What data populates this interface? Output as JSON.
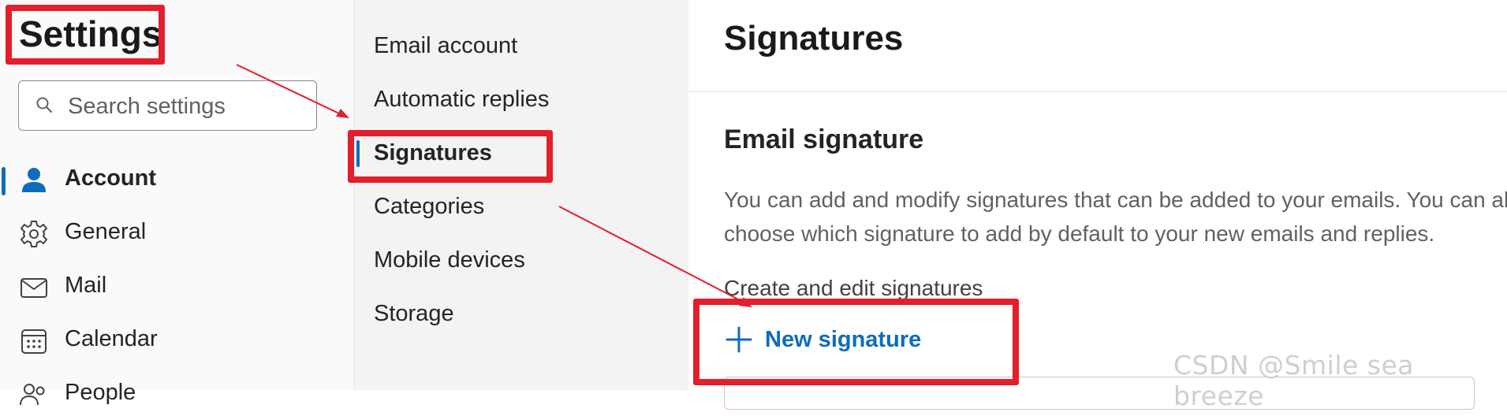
{
  "sidebar": {
    "title": "Settings",
    "search": {
      "placeholder": "Search settings",
      "icon": "search-icon"
    },
    "items": [
      {
        "label": "Account",
        "icon": "person-icon",
        "active": true
      },
      {
        "label": "General",
        "icon": "gear-icon",
        "active": false
      },
      {
        "label": "Mail",
        "icon": "mail-icon",
        "active": false
      },
      {
        "label": "Calendar",
        "icon": "calendar-icon",
        "active": false
      },
      {
        "label": "People",
        "icon": "people-icon",
        "active": false
      }
    ]
  },
  "subnav": {
    "items": [
      {
        "label": "Email account",
        "active": false
      },
      {
        "label": "Automatic replies",
        "active": false
      },
      {
        "label": "Signatures",
        "active": true
      },
      {
        "label": "Categories",
        "active": false
      },
      {
        "label": "Mobile devices",
        "active": false
      },
      {
        "label": "Storage",
        "active": false
      }
    ]
  },
  "main": {
    "title": "Signatures",
    "section_title": "Email signature",
    "description": "You can add and modify signatures that can be added to your emails. You can also choose which signature to add by default to your new emails and replies.",
    "subsection_title": "Create and edit signatures",
    "new_signature_label": "New signature"
  },
  "watermark": "CSDN @Smile sea breeze",
  "colors": {
    "accent": "#0f6cbd",
    "highlight": "#e31e2d",
    "sidebar_bg": "#fafafa",
    "subnav_bg": "#f3f3f3"
  }
}
